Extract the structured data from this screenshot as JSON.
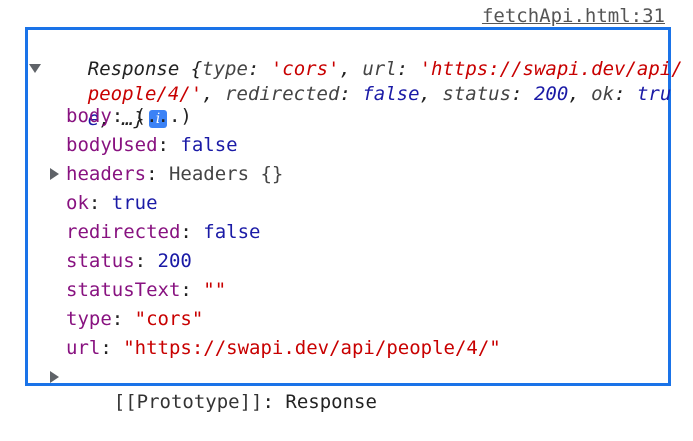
{
  "source_link": "fetchApi.html:31",
  "summary": {
    "line1": {
      "prefix": "Response {",
      "k1": "type",
      "sep1": ": ",
      "v1": "'cors'",
      "sep2": ", ",
      "k2": "url",
      "sep3": ": ",
      "v2": "'https://swapi.dev/api/"
    },
    "line2": {
      "v2cont": "people/4/'",
      "sep1": ", ",
      "k3": "redirected",
      "sep2": ": ",
      "v3": "false",
      "sep3": ", ",
      "k4": "status",
      "sep4": ": ",
      "v4": "200",
      "sep5": ", ",
      "k5": "ok",
      "sep6": ": ",
      "v5": "tru"
    },
    "line3": {
      "v5cont": "e",
      "rest": ", …}"
    },
    "info_badge": "i"
  },
  "properties": [
    {
      "key": "body",
      "sep": ": ",
      "value": "(...)",
      "type": "plain"
    },
    {
      "key": "bodyUsed",
      "sep": ": ",
      "value": "false",
      "type": "value"
    },
    {
      "key": "headers",
      "sep": ": ",
      "value": "Headers {}",
      "type": "object"
    },
    {
      "key": "ok",
      "sep": ": ",
      "value": "true",
      "type": "value"
    },
    {
      "key": "redirected",
      "sep": ": ",
      "value": "false",
      "type": "value"
    },
    {
      "key": "status",
      "sep": ": ",
      "value": "200",
      "type": "value"
    },
    {
      "key": "statusText",
      "sep": ": ",
      "value": "\"\"",
      "type": "string"
    },
    {
      "key": "type",
      "sep": ": ",
      "value": "\"cors\"",
      "type": "string"
    },
    {
      "key": "url",
      "sep": ": ",
      "value": "\"https://swapi.dev/api/people/4/\"",
      "type": "string"
    }
  ],
  "prototype": {
    "key": "[[Prototype]]",
    "sep": ": ",
    "value": "Response"
  },
  "colors": {
    "border": "#1a73e8",
    "key": "#881280",
    "string": "#c80000",
    "value": "#1a1aa6"
  }
}
